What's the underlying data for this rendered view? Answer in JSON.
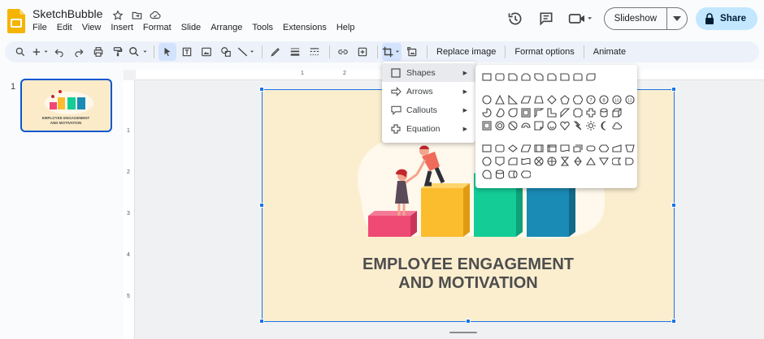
{
  "app": {
    "title": "SketchBubble"
  },
  "menu": [
    "File",
    "Edit",
    "View",
    "Insert",
    "Format",
    "Slide",
    "Arrange",
    "Tools",
    "Extensions",
    "Help"
  ],
  "header": {
    "slideshow_label": "Slideshow",
    "share_label": "Share"
  },
  "toolbar": {
    "replace_image": "Replace image",
    "format_options": "Format options",
    "animate": "Animate"
  },
  "ruler": {
    "h": [
      "1",
      "2"
    ],
    "v": [
      "1",
      "2",
      "3",
      "4",
      "5"
    ]
  },
  "filmstrip": {
    "slide_number": "1"
  },
  "slide": {
    "title_line1": "EMPLOYEE ENGAGEMENT",
    "title_line2": "AND MOTIVATION",
    "thumb_line1": "EMPLOYEE ENGAGEMENT",
    "thumb_line2": "AND MOTIVATION"
  },
  "shape_menu": [
    {
      "label": "Shapes",
      "icon": "square-shape-icon"
    },
    {
      "label": "Arrows",
      "icon": "arrow-shape-icon"
    },
    {
      "label": "Callouts",
      "icon": "callout-icon"
    },
    {
      "label": "Equation",
      "icon": "plus-equation-icon"
    }
  ],
  "colors": {
    "accent": "#0b57d0",
    "share_bg": "#c2e7ff",
    "bar_pink": "#ef4a73",
    "bar_yellow": "#fbbd2e",
    "bar_green": "#14cc96",
    "bar_blue": "#1a8bb5",
    "slide_bg": "#fbeecf",
    "title_text": "#4d4d4d"
  }
}
